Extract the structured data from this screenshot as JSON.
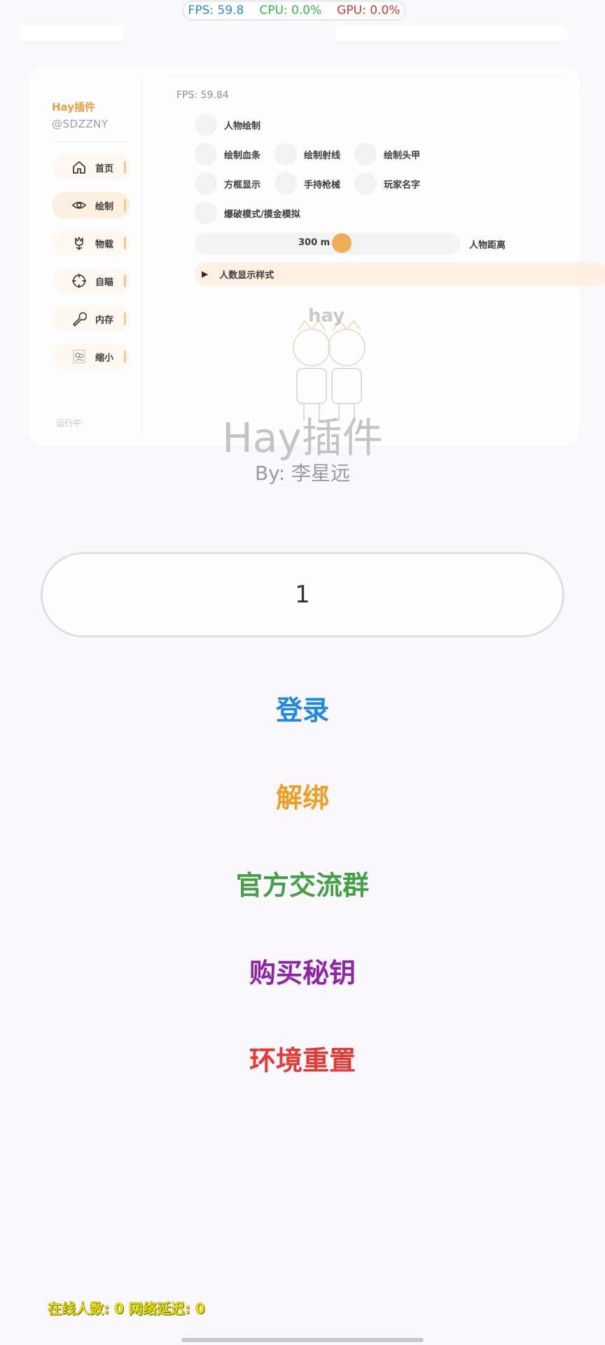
{
  "stats": {
    "fps": "FPS: 59.8",
    "cpu": "CPU: 0.0%",
    "gpu": "GPU: 0.0%"
  },
  "menu": {
    "brand": "Hay插件",
    "user_id": "@SDZZNY",
    "fps": "FPS: 59.84",
    "sidebar": [
      {
        "label": "首页",
        "icon": "home-icon"
      },
      {
        "label": "绘制",
        "icon": "eye-icon"
      },
      {
        "label": "物载",
        "icon": "flower-icon"
      },
      {
        "label": "自瞄",
        "icon": "crosshair-icon"
      },
      {
        "label": "内存",
        "icon": "wrench-icon"
      },
      {
        "label": "缩小",
        "icon": "avatar-icon"
      }
    ],
    "status": "运行中·",
    "options": {
      "player_draw": "人物绘制",
      "health_bar": "绘制血条",
      "ray": "绘制射线",
      "helmet": "绘制头甲",
      "box": "方框显示",
      "weapon": "手持枪械",
      "player_name": "玩家名字",
      "demolition": "爆破模式/摸金模拟"
    },
    "distance_slider": {
      "value_text": "300 m",
      "label": "人物距离",
      "value": 300
    },
    "count_style": "人数显示样式",
    "watermark": "hay"
  },
  "login": {
    "title": "Hay插件",
    "subtitle": "By: 李星远",
    "key_value": "1",
    "buttons": {
      "login": "登录",
      "unbind": "解绑",
      "group": "官方交流群",
      "buy": "购买秘钥",
      "reset": "环境重置"
    },
    "colors": {
      "login": "#1e88e5",
      "unbind": "#f0a020",
      "group": "#43a047",
      "buy": "#8e24aa",
      "reset": "#e53935"
    }
  },
  "footer": {
    "status": "在线人数: 0 网络延迟: 0"
  }
}
